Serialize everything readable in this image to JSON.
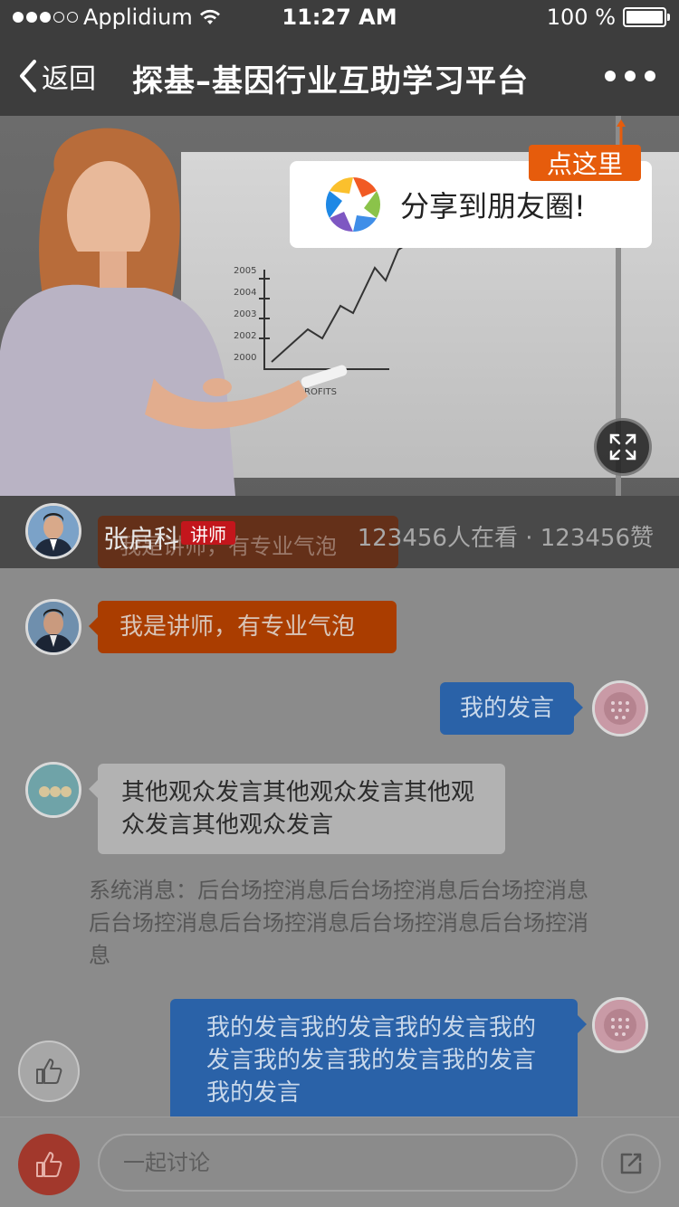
{
  "status_bar": {
    "carrier": "Applidium",
    "time": "11:27 AM",
    "battery": "100 %",
    "signal_dots": 5,
    "signal_filled": 3
  },
  "nav": {
    "back_label": "返回",
    "title": "探基–基因行业互助学习平台",
    "more_icon": "more-dots-icon"
  },
  "share_popup": {
    "label": "分享到朋友圈!",
    "tip": "点这里"
  },
  "live_info": {
    "teacher_name": "张启科",
    "role_badge": "讲师",
    "stats": "123456人在看 · 123456赞",
    "ghost_text": "我是讲师，有专业气泡"
  },
  "messages": {
    "teacher": "我是讲师，有专业气泡",
    "mine_short": "我的发言",
    "other": "其他观众发言其他观众发言其他观众发言其他观众发言",
    "system": "系统消息：后台场控消息后台场控消息后台场控消息后台场控消息后台场控消息后台场控消息后台场控消息",
    "mine_long": "我的发言我的发言我的发言我的发言我的发言我的发言我的发言我的发言"
  },
  "bottom_bar": {
    "placeholder": "一起讨论"
  },
  "colors": {
    "accent_orange": "#e65c0c",
    "role_red": "#c3161c",
    "mine_blue": "#2a62a8",
    "like_red": "#a2382c"
  }
}
